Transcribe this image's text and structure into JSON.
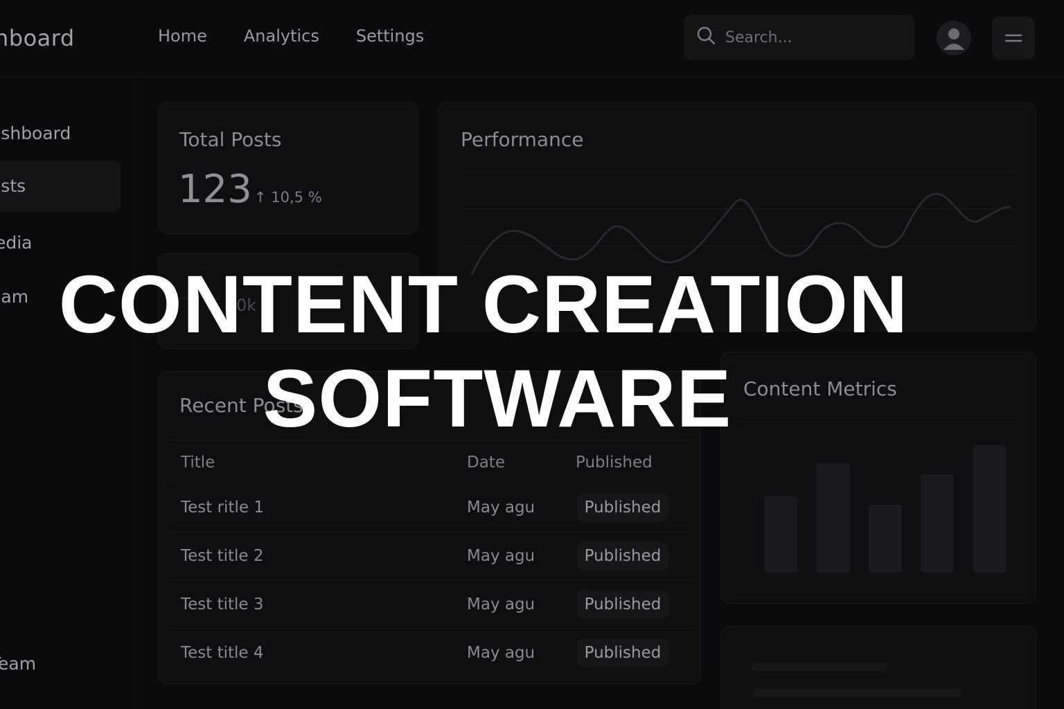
{
  "brand": {
    "title": "hboard"
  },
  "nav": {
    "items": [
      "Home",
      "Analytics",
      "Settings"
    ]
  },
  "search": {
    "placeholder": "Search..."
  },
  "sidebar": {
    "items": [
      {
        "label": "ashboard"
      },
      {
        "label": "osts",
        "active": true
      },
      {
        "label": "ledia"
      },
      {
        "label": "eam"
      }
    ],
    "bottom_label": "Team"
  },
  "stats": {
    "title": "Total Posts",
    "value": "123",
    "delta": "↑ 10,5 %"
  },
  "small_card": {
    "text": "0k"
  },
  "performance": {
    "title": "Performance"
  },
  "recent_posts": {
    "title": "Recent Posts",
    "columns": [
      "Title",
      "Date",
      "Published"
    ],
    "rows": [
      {
        "title": "Test ritle 1",
        "date": "May agu",
        "status": "Published"
      },
      {
        "title": "Test title 2",
        "date": "May agu",
        "status": "Published"
      },
      {
        "title": "Test title 3",
        "date": "May agu",
        "status": "Published"
      },
      {
        "title": "Test title 4",
        "date": "May agu",
        "status": "Published"
      }
    ]
  },
  "content_metrics": {
    "title": "Content Metrics"
  },
  "headline": {
    "line1": "CONTENT CREATION",
    "line2": "SOFTWARE"
  },
  "colors": {
    "background": "#0b0b0d",
    "card": "#0f0f12",
    "headline": "#ffffff",
    "muted_text": "#8e8e93"
  },
  "icons": [
    "search-icon",
    "user-icon",
    "hamburger-icon"
  ]
}
